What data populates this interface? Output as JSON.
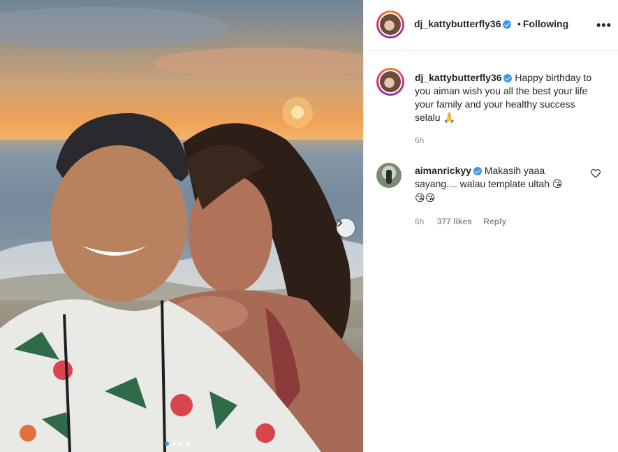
{
  "post": {
    "author": "dj_kattybutterfly36",
    "follow_separator": "•",
    "follow_status": "Following",
    "more_glyph": "•••"
  },
  "caption": {
    "username": "dj_kattybutterfly36",
    "text": "Happy birthday to you aiman wish you all the best your life your family and your healthy success selalu",
    "emoji": "🙏",
    "time": "6h"
  },
  "comments": [
    {
      "username": "aimanrickyy",
      "text": "Makasih yaaa sayang.... walau template ultah",
      "emoji_inline": "😘",
      "emoji_line2": "😘😘",
      "time": "6h",
      "likes": "377 likes",
      "reply": "Reply"
    }
  ],
  "carousel": {
    "slides": 4,
    "active": 1
  },
  "colors": {
    "accent": "#3897f0",
    "text": "#262626",
    "muted": "#8e8e8e"
  }
}
